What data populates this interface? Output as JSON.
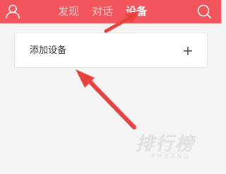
{
  "header": {
    "background_color": "#f2545b",
    "left_icon": "user-icon",
    "right_icon": "search-icon",
    "tabs": [
      {
        "label": "发现",
        "active": false
      },
      {
        "label": "对话",
        "active": false
      },
      {
        "label": "设备",
        "active": true
      }
    ]
  },
  "main": {
    "add_device_label": "添加设备",
    "add_icon": "plus-icon"
  },
  "annotation": {
    "arrow_color": "#e8423f"
  },
  "watermark": {
    "main_text": "排行榜",
    "sub_text": "PHBANG"
  }
}
